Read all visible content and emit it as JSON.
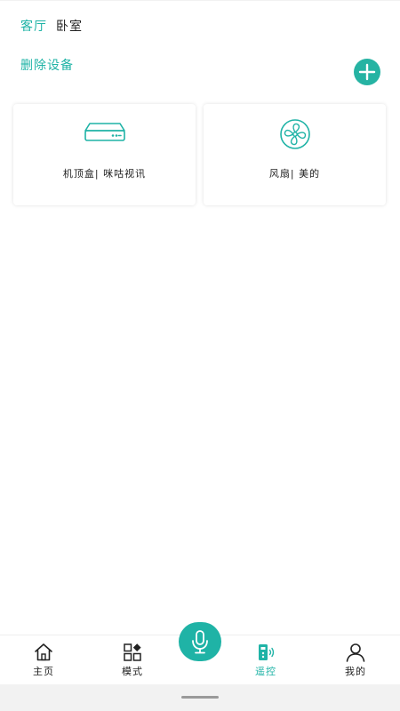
{
  "rooms": {
    "tabs": [
      {
        "label": "客厅",
        "active": true
      },
      {
        "label": "卧室",
        "active": false
      }
    ]
  },
  "actions": {
    "delete_label": "删除设备",
    "add_icon": "plus-icon"
  },
  "devices": [
    {
      "label": "机顶盒| 咪咕视讯",
      "icon": "set-top-box-icon"
    },
    {
      "label": "风扇| 美的",
      "icon": "fan-icon"
    }
  ],
  "bottom_nav": {
    "items": [
      {
        "label": "主页",
        "icon": "home-icon",
        "active": false
      },
      {
        "label": "模式",
        "icon": "mode-icon",
        "active": false
      },
      {
        "label": "遥控",
        "icon": "remote-icon",
        "active": true
      },
      {
        "label": "我的",
        "icon": "profile-icon",
        "active": false
      }
    ],
    "mic_icon": "microphone-icon"
  },
  "colors": {
    "accent": "#1fb3a6",
    "text": "#222222",
    "system_bar": "#f2f2f2"
  }
}
